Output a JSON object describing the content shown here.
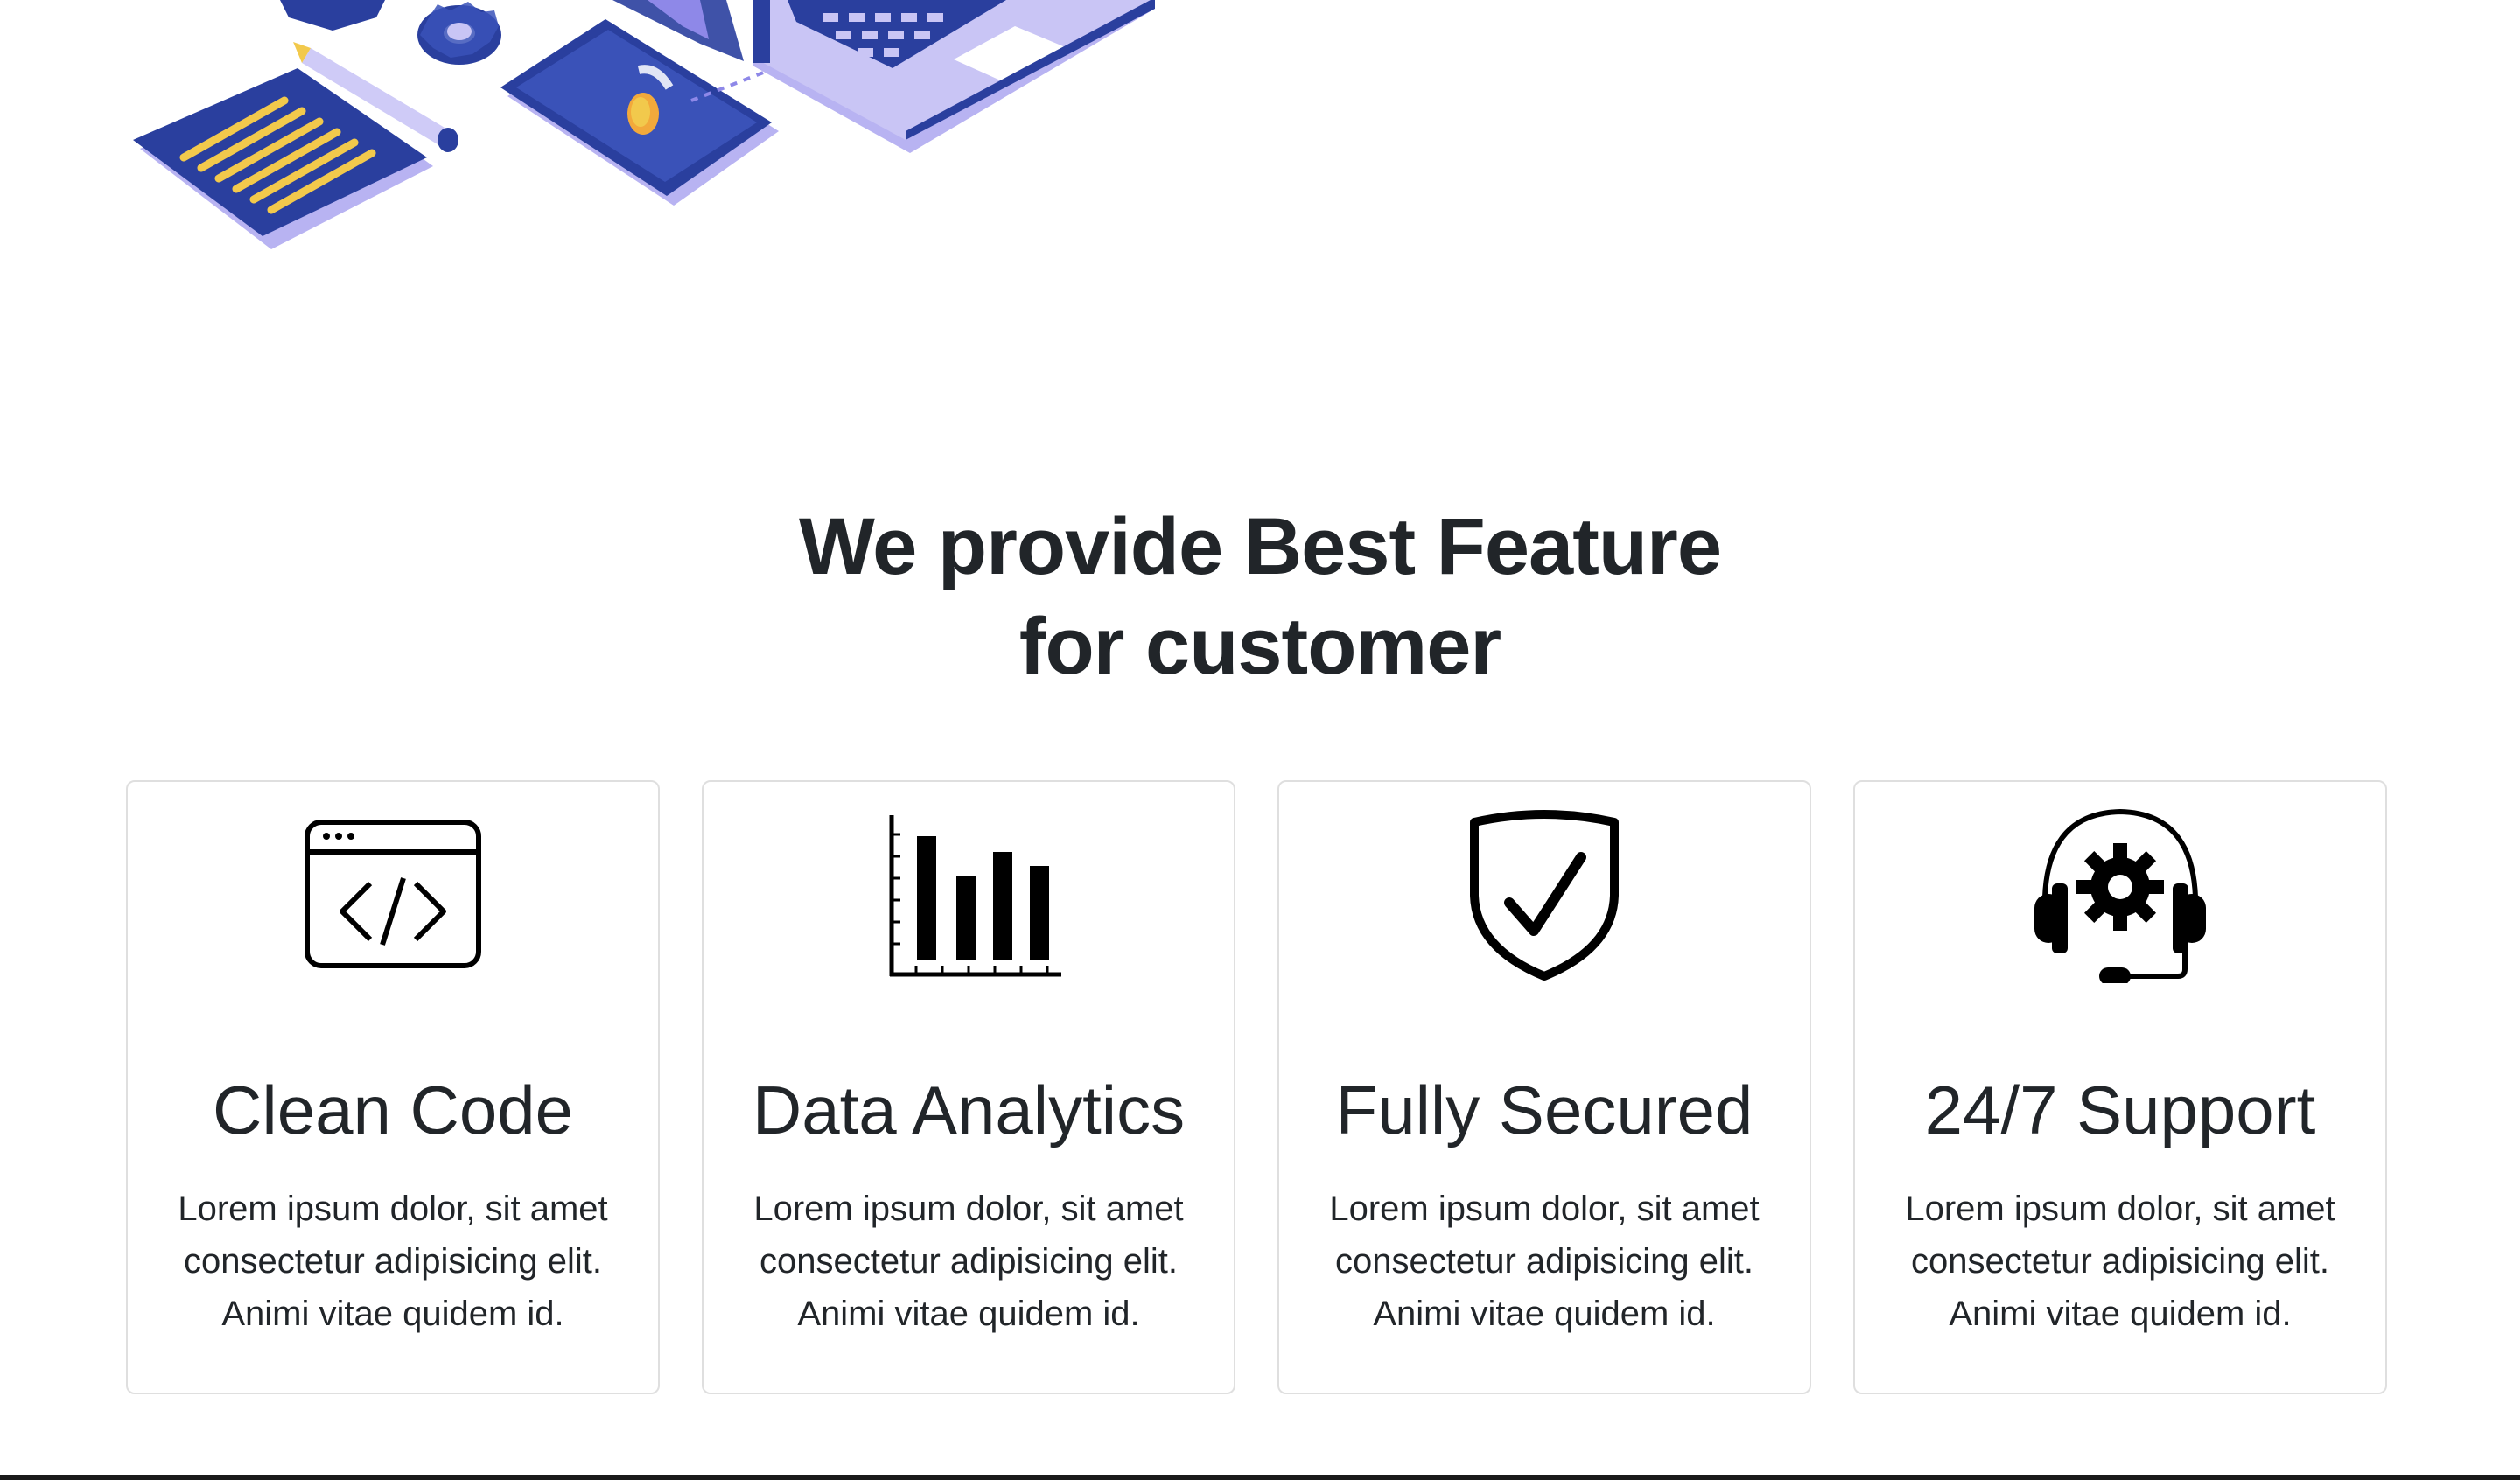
{
  "section": {
    "headline_line1": "We provide Best Feature",
    "headline_line2": "for customer"
  },
  "features": [
    {
      "title": "Clean Code",
      "text": "Lorem ipsum dolor, sit amet consectetur adipisicing elit. Animi vitae quidem id.",
      "icon": "code-window-icon"
    },
    {
      "title": "Data Analytics",
      "text": "Lorem ipsum dolor, sit amet consectetur adipisicing elit. Animi vitae quidem id.",
      "icon": "bar-chart-icon"
    },
    {
      "title": "Fully Secured",
      "text": "Lorem ipsum dolor, sit amet consectetur adipisicing elit. Animi vitae quidem id.",
      "icon": "shield-check-icon"
    },
    {
      "title": "24/7 Support",
      "text": "Lorem ipsum dolor, sit amet consectetur adipisicing elit. Animi vitae quidem id.",
      "icon": "headset-gear-icon"
    }
  ],
  "colors": {
    "accent_blue": "#2a3f9e",
    "accent_lavender": "#a9a3ee",
    "accent_yellow": "#f2c94c",
    "text": "#212529",
    "card_border": "#dfdfdf"
  }
}
